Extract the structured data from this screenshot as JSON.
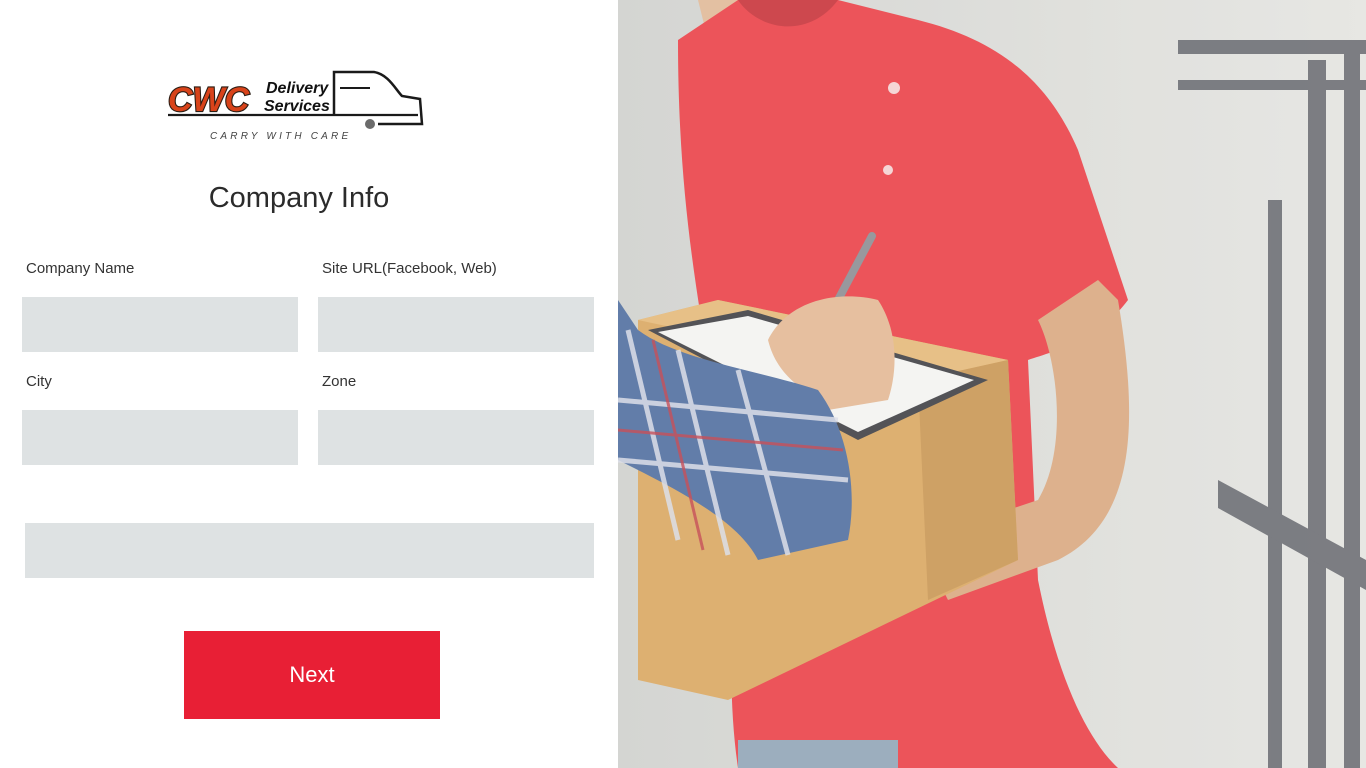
{
  "brand": {
    "logo_letters": "CWC",
    "logo_line1": "Delivery",
    "logo_line2": "Services",
    "tagline": "CARRY WITH CARE"
  },
  "form": {
    "title": "Company Info",
    "fields": {
      "company_name": {
        "label": "Company Name",
        "value": ""
      },
      "site_url": {
        "label": "Site URL(Facebook, Web)",
        "value": ""
      },
      "city": {
        "label": "City",
        "value": ""
      },
      "zone": {
        "label": "Zone",
        "value": ""
      },
      "extra": {
        "value": ""
      }
    },
    "next_label": "Next"
  },
  "hero": {
    "image": "delivery-person-photo"
  },
  "colors": {
    "accent": "#e81f35",
    "logo_orange": "#d8431a",
    "input_bg": "#dee2e3",
    "shirt_red": "#ea3d44"
  }
}
